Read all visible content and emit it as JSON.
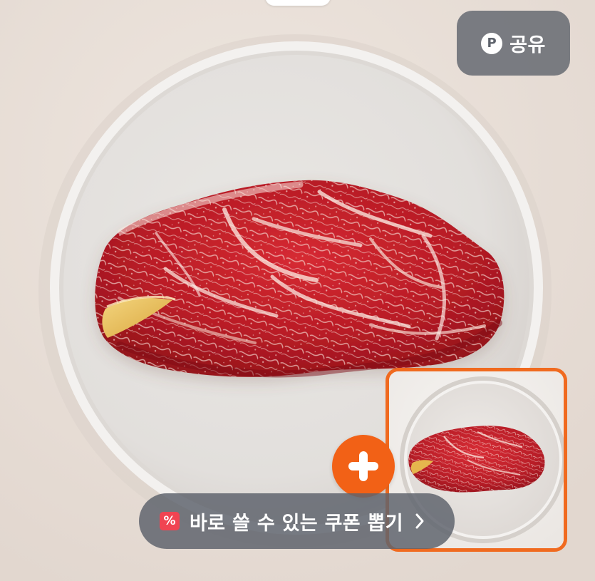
{
  "share": {
    "icon": "P",
    "label": "공유"
  },
  "coupon": {
    "icon": "%",
    "label": "바로 쓸 수 있는 쿠폰 뽑기"
  },
  "colors": {
    "accent": "#f26116",
    "thumb_border": "#f06a1f",
    "overlay": "#5e636c",
    "coupon_badge": "#f04452"
  },
  "icons": {
    "share": "p-circle-icon",
    "plus": "plus-icon",
    "coupon": "percent-icon",
    "chevron": "chevron-right-icon"
  }
}
